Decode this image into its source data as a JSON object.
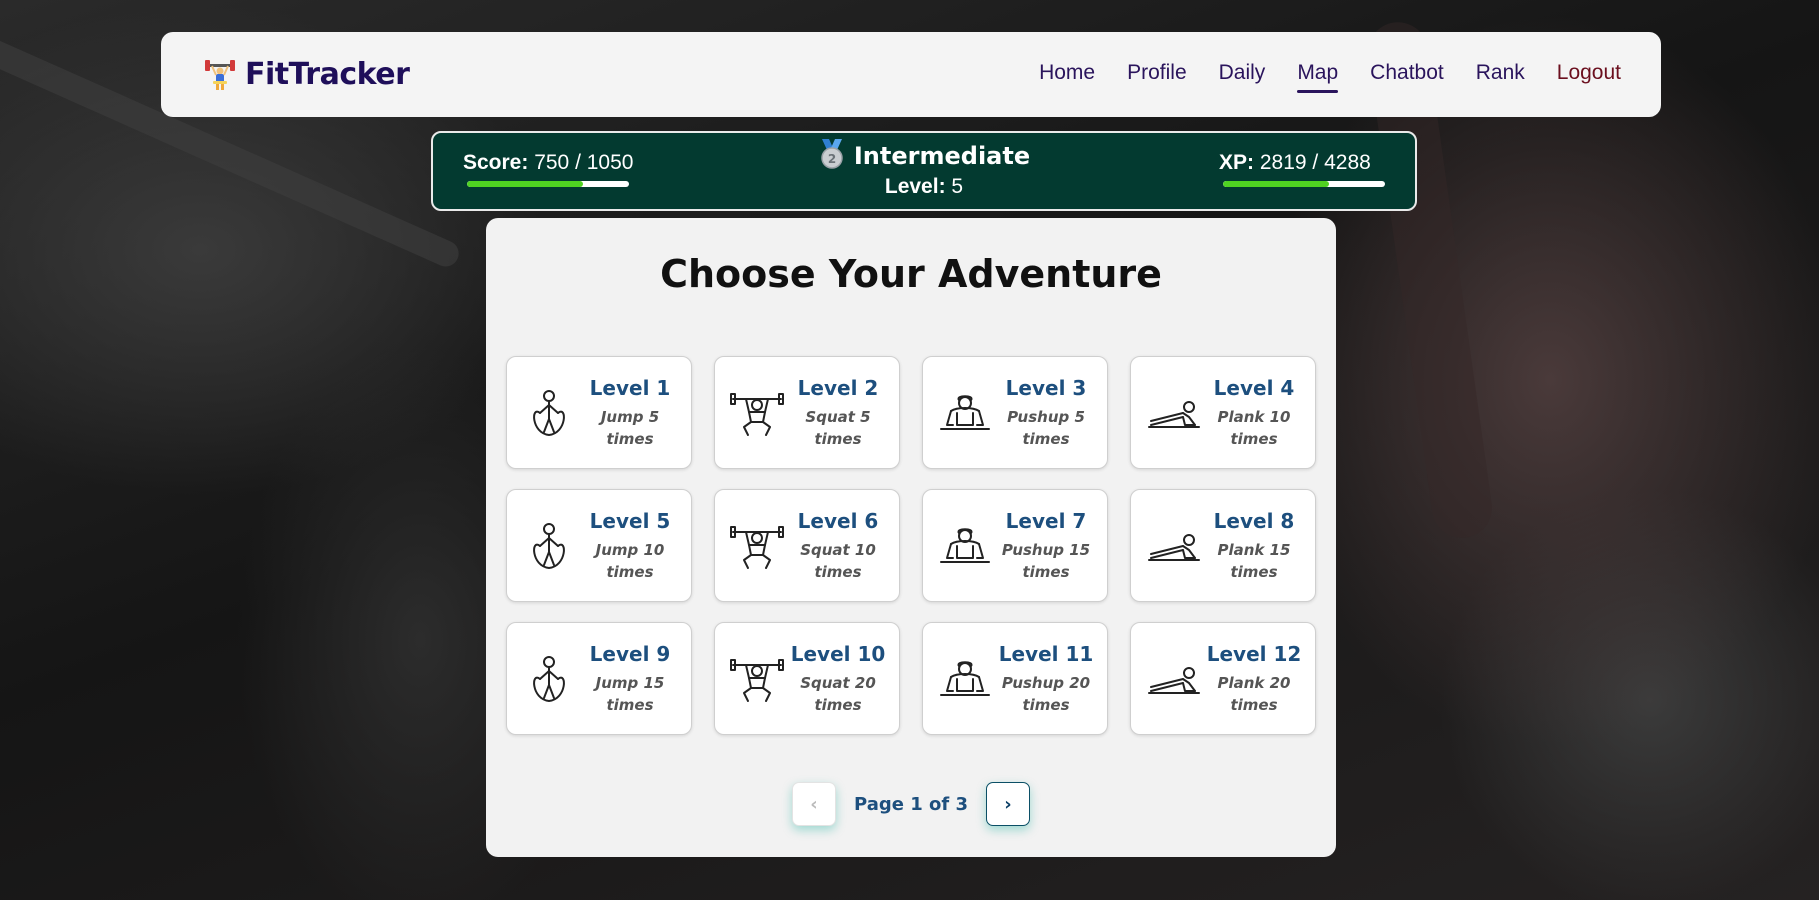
{
  "app": {
    "name": "FitTracker"
  },
  "nav": {
    "items": [
      {
        "label": "Home",
        "active": false
      },
      {
        "label": "Profile",
        "active": false
      },
      {
        "label": "Daily",
        "active": false
      },
      {
        "label": "Map",
        "active": true
      },
      {
        "label": "Chatbot",
        "active": false
      },
      {
        "label": "Rank",
        "active": false
      },
      {
        "label": "Logout",
        "active": false
      }
    ]
  },
  "status": {
    "score_label": "Score:",
    "score_value": "750 / 1050",
    "score_fraction": 0.714,
    "rank_badge": "2",
    "rank": "Intermediate",
    "level_label": "Level:",
    "level_value": "5",
    "xp_label": "XP:",
    "xp_value": "2819 / 4288",
    "xp_fraction": 0.657,
    "progress_color": "#4fd322",
    "bar_bg_color": "#033a30"
  },
  "main": {
    "title": "Choose Your Adventure",
    "levels": [
      {
        "level": "Level 1",
        "task": "Jump 5 times",
        "icon": "jump-rope-icon"
      },
      {
        "level": "Level 2",
        "task": "Squat 5 times",
        "icon": "squat-icon"
      },
      {
        "level": "Level 3",
        "task": "Pushup 5 times",
        "icon": "pushup-icon"
      },
      {
        "level": "Level 4",
        "task": "Plank 10 times",
        "icon": "plank-icon"
      },
      {
        "level": "Level 5",
        "task": "Jump 10 times",
        "icon": "jump-rope-icon"
      },
      {
        "level": "Level 6",
        "task": "Squat 10 times",
        "icon": "squat-icon"
      },
      {
        "level": "Level 7",
        "task": "Pushup 15 times",
        "icon": "pushup-icon"
      },
      {
        "level": "Level 8",
        "task": "Plank 15 times",
        "icon": "plank-icon"
      },
      {
        "level": "Level 9",
        "task": "Jump 15 times",
        "icon": "jump-rope-icon"
      },
      {
        "level": "Level 10",
        "task": "Squat 20 times",
        "icon": "squat-icon"
      },
      {
        "level": "Level 11",
        "task": "Pushup 20 times",
        "icon": "pushup-icon"
      },
      {
        "level": "Level 12",
        "task": "Plank 20 times",
        "icon": "plank-icon"
      }
    ],
    "pager": {
      "prev_label": "‹",
      "next_label": "›",
      "page_info": "Page 1 of 3"
    }
  }
}
